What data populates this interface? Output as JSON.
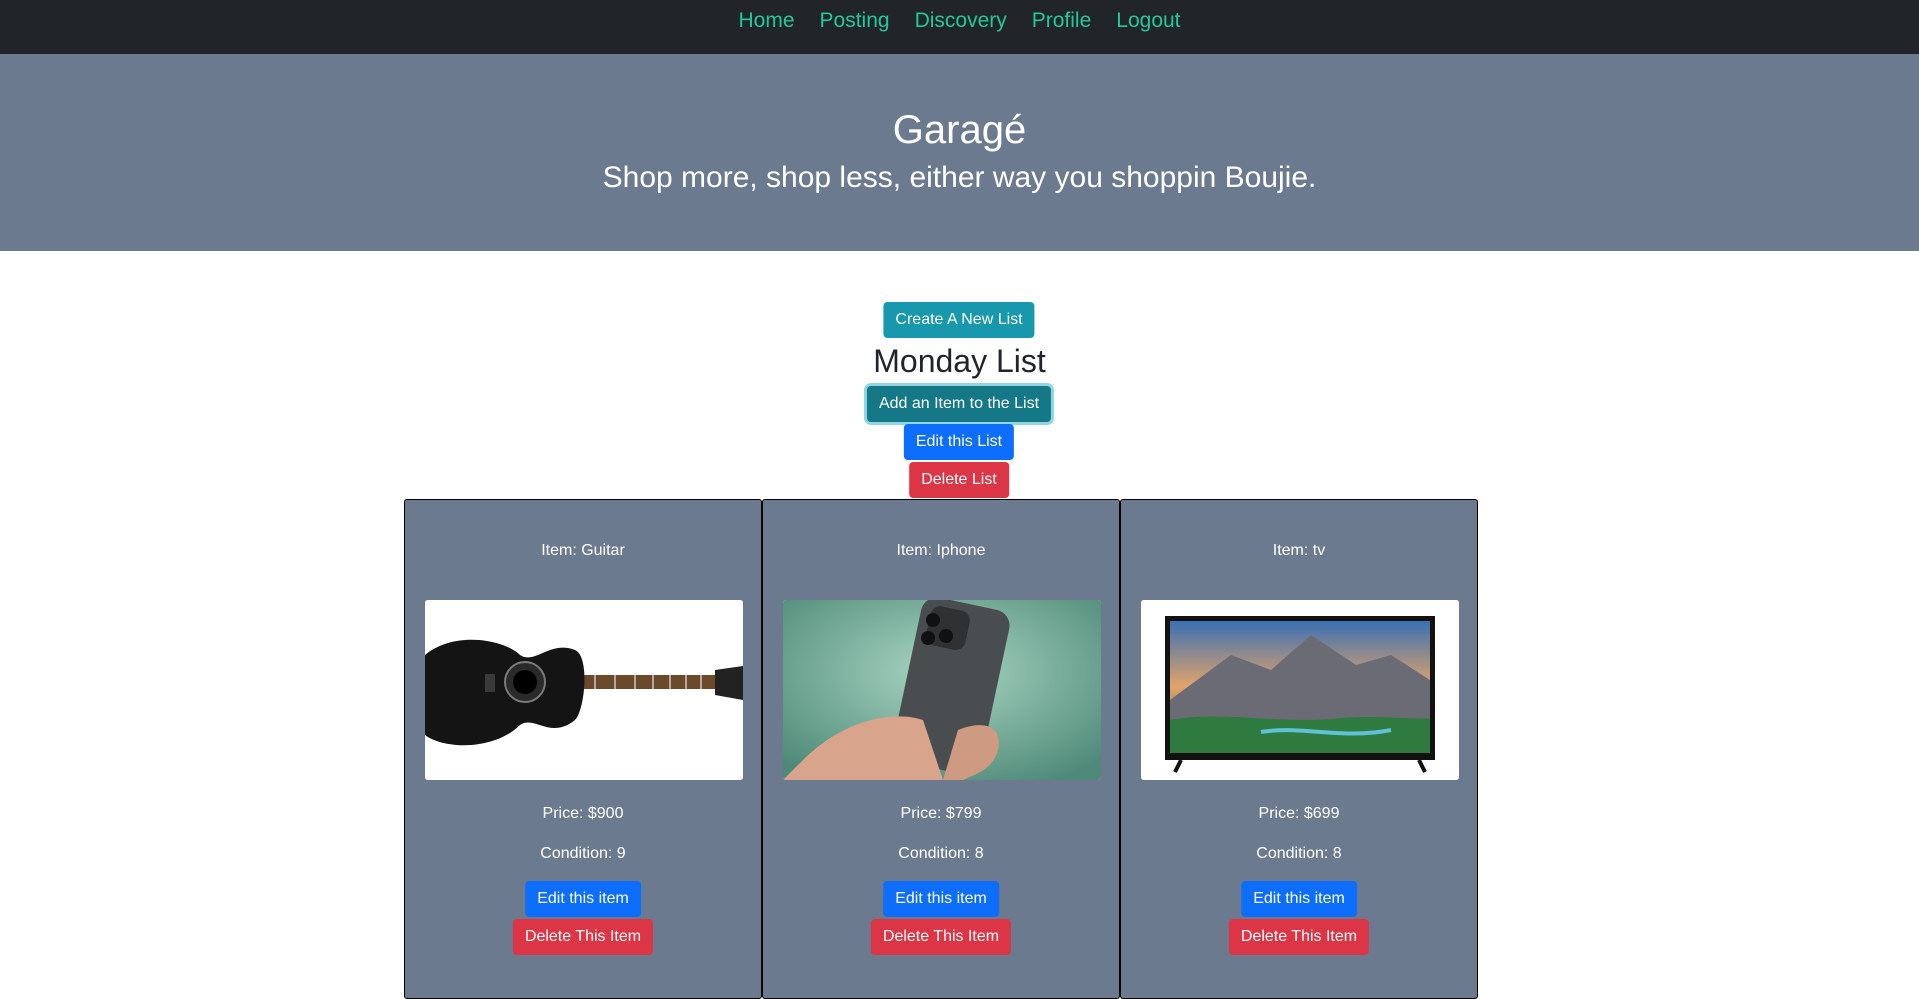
{
  "nav": {
    "links": [
      "Home",
      "Posting",
      "Discovery",
      "Profile",
      "Logout"
    ]
  },
  "hero": {
    "title": "Garagé",
    "subtitle": "Shop more, shop less, either way you shoppin Boujie."
  },
  "list": {
    "create_label": "Create A New List",
    "title": "Monday List",
    "add_label": "Add an Item to the List",
    "edit_label": "Edit this List",
    "delete_label": "Delete List"
  },
  "items": [
    {
      "label": "Item: Guitar",
      "price": "Price: $900",
      "condition": "Condition: 9",
      "image": "guitar-photo",
      "edit_label": "Edit this item",
      "delete_label": "Delete This Item"
    },
    {
      "label": "Item: Iphone",
      "price": "Price: $799",
      "condition": "Condition: 8",
      "image": "iphone-photo",
      "edit_label": "Edit this item",
      "delete_label": "Delete This Item"
    },
    {
      "label": "Item: tv",
      "price": "Price: $699",
      "condition": "Condition: 8",
      "image": "tv-photo",
      "edit_label": "Edit this item",
      "delete_label": "Delete This Item"
    }
  ],
  "colors": {
    "navbar": "#212529",
    "nav_link": "#20c997",
    "hero": "#6c7a8f",
    "card": "#6c7a8f",
    "primary": "#0d6efd",
    "danger": "#dc3545",
    "info": "#1798ad"
  }
}
